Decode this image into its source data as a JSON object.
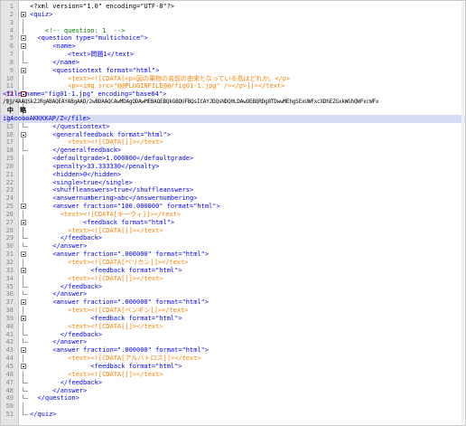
{
  "editor": {
    "lines": [
      {
        "num": "1",
        "text": "<?xml version=\"1.0\" encoding=\"UTF-8\"?>"
      },
      {
        "num": "2",
        "text": "<quiz>"
      },
      {
        "num": "3",
        "text": ""
      },
      {
        "num": "4",
        "text": "    <!-- question: 1  -->"
      },
      {
        "num": "5",
        "text": "  <question type=\"multichoice\">"
      },
      {
        "num": "6",
        "text": "      <name>"
      },
      {
        "num": "7",
        "text": "          <text>問題1</text>"
      },
      {
        "num": "8",
        "text": "      </name>"
      },
      {
        "num": "9",
        "text": "      <questiontext format=\"html\">"
      },
      {
        "num": "10",
        "text": "          <text><![CDATA[<p>図の果物の名前の由来となっている島はどれか。</p>"
      },
      {
        "num": "11",
        "text": "          <p><img src=\"@@PLUGINFILE@@/fig01-1.jpg\" /></p>]]></text>"
      },
      {
        "num": "12",
        "text": "<file name=\"fig01-1.jpg\" encoding=\"base64\">"
      },
      {
        "num": "13",
        "text": "/9j/4AAQSkZJRgABAQEAYABgAAD/2wBDAAQCAwMDAgQDAwMEBAQEBQkGBQUFBQsICAYJDQsNDQ0LDAwOEBQRDg8TDwwMEhgSExUWFxcXDhEZGxkWGhQWFxcWFx"
      },
      {
        "num": "",
        "text": "  中   略"
      },
      {
        "num": "14",
        "text": "igAooooAKKKKAP/Z</file>"
      },
      {
        "num": "15",
        "text": "      </questiontext>"
      },
      {
        "num": "16",
        "text": "      <generalfeedback format=\"html\">"
      },
      {
        "num": "17",
        "text": "          <text><![CDATA[]]></text>"
      },
      {
        "num": "18",
        "text": "      </generalfeedback>"
      },
      {
        "num": "19",
        "text": "      <defaultgrade>1.000000</defaultgrade>"
      },
      {
        "num": "20",
        "text": "      <penalty>33.333330</penalty>"
      },
      {
        "num": "21",
        "text": "      <hidden>0</hidden>"
      },
      {
        "num": "22",
        "text": "      <single>true</single>"
      },
      {
        "num": "23",
        "text": "      <shuffleanswers>true</shuffleanswers>"
      },
      {
        "num": "24",
        "text": "      <answernumbering>abc</answernumbering>"
      },
      {
        "num": "25",
        "text": "      <answer fraction=\"100.000000\" format=\"html\">"
      },
      {
        "num": "26",
        "text": "        <text><![CDATA[キーウィ]]></text>"
      },
      {
        "num": "27",
        "text": "              <feedback format=\"html\">"
      },
      {
        "num": "28",
        "text": "          <text><![CDATA[]]></text>"
      },
      {
        "num": "29",
        "text": "        </feedback>"
      },
      {
        "num": "30",
        "text": "      </answer>"
      },
      {
        "num": "31",
        "text": "      <answer fraction=\".000000\" format=\"html\">"
      },
      {
        "num": "32",
        "text": "          <text><![CDATA[ベリカン]]></text>"
      },
      {
        "num": "33",
        "text": "                <feedback format=\"html\">"
      },
      {
        "num": "34",
        "text": "          <text><![CDATA[]]></text>"
      },
      {
        "num": "35",
        "text": "        </feedback>"
      },
      {
        "num": "36",
        "text": "      </answer>"
      },
      {
        "num": "37",
        "text": "      <answer fraction=\".000000\" format=\"html\">"
      },
      {
        "num": "38",
        "text": "          <text><![CDATA[ペンギン]]></text>"
      },
      {
        "num": "39",
        "text": "                <feedback format=\"html\">"
      },
      {
        "num": "40",
        "text": "          <text><![CDATA[]]></text>"
      },
      {
        "num": "41",
        "text": "        </feedback>"
      },
      {
        "num": "42",
        "text": "      </answer>"
      },
      {
        "num": "43",
        "text": "      <answer fraction=\".000000\" format=\"html\">"
      },
      {
        "num": "44",
        "text": "          <text><![CDATA[アルバトロス]]></text>"
      },
      {
        "num": "45",
        "text": "                <feedback format=\"html\">"
      },
      {
        "num": "46",
        "text": "          <text><![CDATA[]]></text>"
      },
      {
        "num": "47",
        "text": "        </feedback>"
      },
      {
        "num": "48",
        "text": "      </answer>"
      },
      {
        "num": "49",
        "text": "  </question>"
      },
      {
        "num": "50",
        "text": ""
      },
      {
        "num": "51",
        "text": "</quiz>"
      }
    ]
  }
}
